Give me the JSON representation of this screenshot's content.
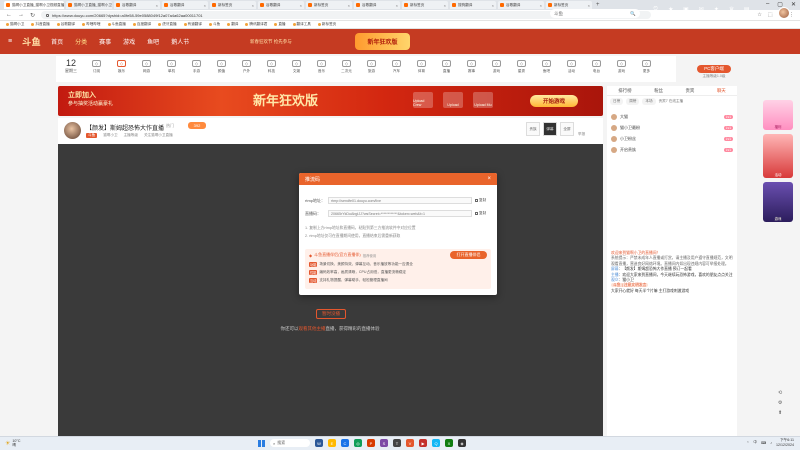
{
  "browser": {
    "tabs": [
      {
        "label": "猫啊小卫直播_猫啊小卫视频直播",
        "active": true
      },
      {
        "label": "猫啊小卫直播_猫啊小卫...",
        "active": false
      },
      {
        "label": "谷歌翻译",
        "active": false
      },
      {
        "label": "谷歌翻译",
        "active": false
      },
      {
        "label": "新标签页",
        "active": false
      },
      {
        "label": "谷歌翻译",
        "active": false
      },
      {
        "label": "新标签页",
        "active": false
      },
      {
        "label": "谷歌翻译",
        "active": false
      },
      {
        "label": "新标签页",
        "active": false
      },
      {
        "label": "搜狗翻译",
        "active": false
      },
      {
        "label": "谷歌翻译",
        "active": false
      },
      {
        "label": "新标签页",
        "active": false
      },
      {
        "label": "百度翻译",
        "active": false
      }
    ],
    "url": "https://www.douyu.com/20665?dyshid=a0fe58-59e0588049f12a07a4a62aa00011701",
    "bookmarks": [
      "猫啊小卫",
      "抖音直播",
      "谷歌翻译",
      "哔哩哔哩",
      "斗鱼直播",
      "百度翻译",
      "虎牙直播",
      "有道翻译",
      "斗鱼",
      "翻译",
      "腾讯翻译君",
      "直播",
      "翻译工具",
      "新标签页"
    ]
  },
  "site": {
    "menu_icon": "≡",
    "logo": "斗鱼",
    "nav": [
      "首页",
      "分类",
      "赛事",
      "游戏",
      "鱼吧",
      "鹅人节"
    ],
    "nav_highlight": "分类",
    "header_promo": "新春狂欢节 抢先参与",
    "header_art": "新年狂欢版",
    "search_placeholder": "斗鱼",
    "search_icon": "🔍",
    "header_icons": [
      {
        "icon": "⏲",
        "label": "历史"
      },
      {
        "icon": "★",
        "label": "关注"
      },
      {
        "icon": "▣",
        "label": "任务"
      },
      {
        "icon": "✉",
        "label": "消息"
      },
      {
        "icon": "✦",
        "label": "鱼丸"
      },
      {
        "icon": "♛",
        "label": "贵族"
      },
      {
        "icon": "▤",
        "label": "更多"
      }
    ]
  },
  "categories": {
    "date_num": "12",
    "date_label": "星期三",
    "items": [
      "订阅",
      "娱乐",
      "网游",
      "单机",
      "手游",
      "颜值",
      "户外",
      "科技",
      "文娱",
      "音乐",
      "二次元",
      "旅游",
      "汽车",
      "体育",
      "直播",
      "赛事",
      "游戏",
      "星秀",
      "鱼吧",
      "活动",
      "电台",
      "游戏",
      "更多"
    ],
    "pc_button": "PC客户端",
    "fans_level": "主播等级1.0级"
  },
  "promo_banner": {
    "left_title": "立即加入",
    "left_sub": "参与抽奖活动赢豪礼",
    "title": "新年狂欢版",
    "tags": [
      "Upload Crew",
      "Upload",
      "Upload Mu"
    ],
    "button": "开始游戏"
  },
  "streamer": {
    "title": "【颜发】斯姆超恐怖大作直播",
    "hot": "热门",
    "count": "392",
    "tag": "斗鱼",
    "meta": [
      "猫啊小卫",
      "主播等级",
      "关注猫啊小卫直播"
    ],
    "right_items": [
      "贵族",
      "弹幕",
      "全屏"
    ],
    "report": "举报"
  },
  "video": {
    "button": "暂时没播",
    "text_prefix": "你还可以",
    "text_link": "观看其他主播",
    "text_suffix": "直播，获得精彩的直播体验"
  },
  "dialog": {
    "title": "推流码",
    "close": "×",
    "rtmp_label": "rtmp地址：",
    "rtmp_value": "rtmp://sendfe01.douyu.com/live",
    "stream_label": "直播码：",
    "stream_value": "20665rYkDuAbgIJJ?wsSecret=************&token=web&t=1",
    "copy": "复制",
    "note1": "1. 复制上方rtmp地址和直播码，粘贴到第三方推流软件中对应位置",
    "note2": "2. rtmp地址仅可在直播期间使用，直播结束后需重新获取",
    "tips_title": "斗鱼直播伴侣(官方直播伴)",
    "tips_sub": "推荐使用",
    "tips_button": "打开直播伴侣",
    "tip_lines": [
      {
        "tag": "功能",
        "text": "场景切换、美颜特效、弹幕互动、音乐播放等功能一应俱全"
      },
      {
        "tag": "性能",
        "text": "编码效率高，画质清晰，CPU占用低，直播更流畅稳定"
      },
      {
        "tag": "互动",
        "text": "支持礼物提醒、弹幕助手，轻松管理直播间"
      }
    ]
  },
  "sidebar": {
    "tabs": [
      "排行榜",
      "粉丝",
      "贵宾",
      "聊天"
    ],
    "active_tab": "聊天",
    "rank_pills": [
      "日榜",
      "周榜",
      "本场"
    ],
    "rank_note": "贵宾7 在线主播",
    "list": [
      {
        "name": "大猫",
        "lv": "Lv1"
      },
      {
        "name": "猫小卫最粉",
        "lv": "Lv1"
      },
      {
        "name": "小卫粉丝",
        "lv": "Lv1"
      },
      {
        "name": "开启贵族",
        "lv": "Lv1"
      }
    ],
    "chat_notice": "欢迎来到猫啊小卫的直播间！",
    "chat_system": "系统提示：严禁未成年人直播或打赏，请主播及用户遵守直播规范，文明观看直播，营造良好网络环境。直播间内如出现违规内容可举报处理。",
    "chat_lines": [
      {
        "name": "屏幕",
        "text": "【颜发】斯姆超恐怖大作直播  预订一起看"
      },
      {
        "name": "主播",
        "text": "欢迎大家来到直播间，今天继续玩恐怖游戏，喜欢的朋友点点关注"
      },
      {
        "name": "观众",
        "text": "猫小卫"
      }
    ],
    "chat_badge": "斗鱼 | 注意文明发言",
    "chat_last": "大家开心就好 每天半个片嘛 主打游戏刺激游戏"
  },
  "side_ads": [
    "福利",
    "活动",
    "游戏"
  ],
  "side_tools": [
    "⟲",
    "⚙",
    "⬆"
  ],
  "taskbar": {
    "weather_temp": "10°C",
    "weather_desc": "晴",
    "search": "搜索",
    "apps": [
      {
        "label": "W",
        "color": "#2b5797"
      },
      {
        "label": "E",
        "color": "#ffb900"
      },
      {
        "label": "C",
        "color": "#1a73e8"
      },
      {
        "label": "◎",
        "color": "#0f9d58"
      },
      {
        "label": "P",
        "color": "#d83b01"
      },
      {
        "label": "S",
        "color": "#7d4aa5"
      },
      {
        "label": "T",
        "color": "#444"
      },
      {
        "label": "V",
        "color": "#e4572e"
      },
      {
        "label": "▶",
        "color": "#c4302b"
      },
      {
        "label": "Q",
        "color": "#12b7f5"
      },
      {
        "label": "X",
        "color": "#107c10"
      },
      {
        "label": "◈",
        "color": "#333"
      }
    ],
    "tray_icons": [
      "⌃",
      "中",
      "⌨",
      "♪"
    ],
    "time": "下午6:11",
    "date": "12/12/2024"
  }
}
